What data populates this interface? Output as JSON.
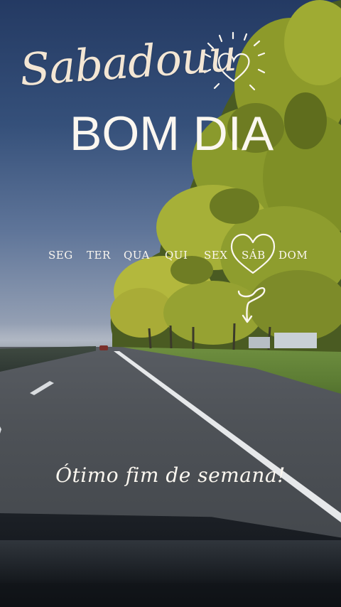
{
  "greeting": {
    "script_line": "Sabadouu",
    "main_line": "BOM DIA"
  },
  "weekdays": [
    "SEG",
    "TER",
    "QUA",
    "QUI",
    "SEX",
    "SÁB",
    "DOM"
  ],
  "highlighted_day": "SÁB",
  "tagline": "Ótimo fim de semana!",
  "colors": {
    "text_cream": "#f3e6d4",
    "text_white": "#fbf7f0",
    "sky_top": "#243a63",
    "foliage": "#a6b038"
  },
  "icons": [
    "heart-icon",
    "heart-outline-icon",
    "squiggle-arrow-icon"
  ]
}
